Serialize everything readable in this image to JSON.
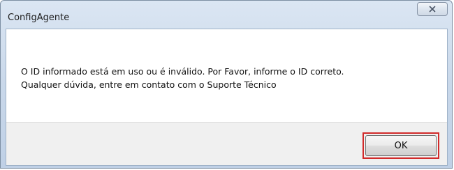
{
  "window": {
    "title": "ConfigAgente",
    "close_icon": "close-icon"
  },
  "dialog": {
    "message_line1": "O ID informado está em uso ou é inválido. Por Favor, informe o ID correto.",
    "message_line2": "Qualquer dúvida, entre em contato com o Suporte Técnico"
  },
  "buttons": {
    "ok_label": "OK"
  },
  "colors": {
    "highlight": "#d12a2a",
    "footer_bg": "#f0f0f0"
  }
}
